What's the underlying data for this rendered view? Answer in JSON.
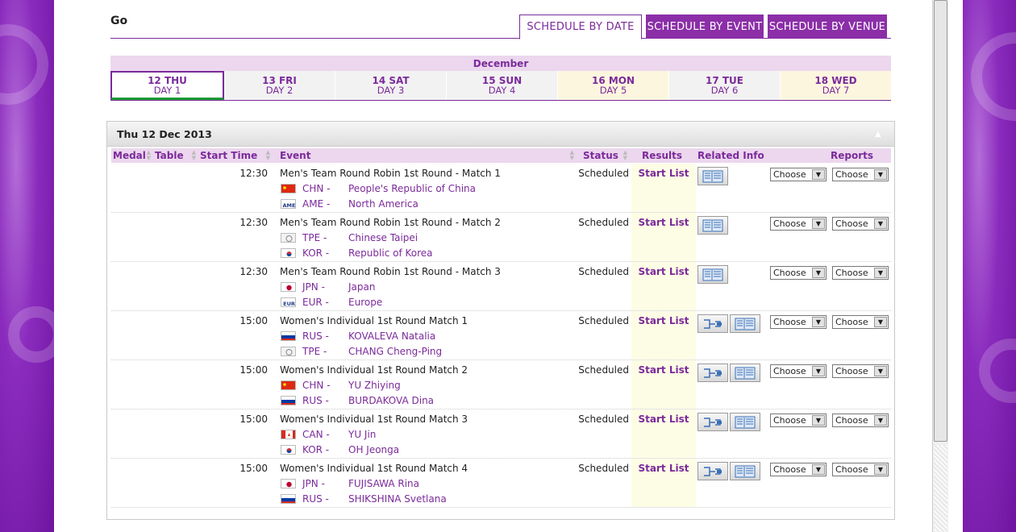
{
  "header": {
    "go_label": "Go",
    "tabs": [
      {
        "label": "SCHEDULE BY DATE",
        "active": true
      },
      {
        "label": "SCHEDULE BY EVENT",
        "active": false
      },
      {
        "label": "SCHEDULE BY VENUE",
        "active": false
      }
    ]
  },
  "calendar": {
    "month": "December",
    "days": [
      {
        "date": "12 THU",
        "day": "DAY 1"
      },
      {
        "date": "13 FRI",
        "day": "DAY 2"
      },
      {
        "date": "14 SAT",
        "day": "DAY 3"
      },
      {
        "date": "15 SUN",
        "day": "DAY 4"
      },
      {
        "date": "16 MON",
        "day": "DAY 5"
      },
      {
        "date": "17 TUE",
        "day": "DAY 6"
      },
      {
        "date": "18 WED",
        "day": "DAY 7"
      }
    ]
  },
  "panel": {
    "title": "Thu 12 Dec 2013",
    "columns": {
      "medal": "Medal",
      "table": "Table",
      "start_time": "Start Time",
      "event": "Event",
      "status": "Status",
      "results": "Results",
      "related_info": "Related Info",
      "reports": "Reports"
    },
    "choose_label": "Choose",
    "rows": [
      {
        "time": "12:30",
        "event": "Men's Team Round Robin 1st Round - Match 1",
        "status": "Scheduled",
        "result": "Start List",
        "c1": {
          "noc": "CHN -",
          "name": "People's Republic of China"
        },
        "c2": {
          "noc": "AME -",
          "name": "North America"
        }
      },
      {
        "time": "12:30",
        "event": "Men's Team Round Robin 1st Round - Match 2",
        "status": "Scheduled",
        "result": "Start List",
        "c1": {
          "noc": "TPE -",
          "name": "Chinese Taipei"
        },
        "c2": {
          "noc": "KOR -",
          "name": "Republic of Korea"
        }
      },
      {
        "time": "12:30",
        "event": "Men's Team Round Robin 1st Round - Match 3",
        "status": "Scheduled",
        "result": "Start List",
        "c1": {
          "noc": "JPN -",
          "name": "Japan"
        },
        "c2": {
          "noc": "EUR -",
          "name": "Europe"
        }
      },
      {
        "time": "15:00",
        "event": "Women's Individual 1st Round Match 1",
        "status": "Scheduled",
        "result": "Start List",
        "c1": {
          "noc": "RUS -",
          "name": "KOVALEVA Natalia"
        },
        "c2": {
          "noc": "TPE -",
          "name": "CHANG Cheng-Ping"
        }
      },
      {
        "time": "15:00",
        "event": "Women's Individual 1st Round Match 2",
        "status": "Scheduled",
        "result": "Start List",
        "c1": {
          "noc": "CHN -",
          "name": "YU Zhiying"
        },
        "c2": {
          "noc": "RUS -",
          "name": "BURDAKOVA Dina"
        }
      },
      {
        "time": "15:00",
        "event": "Women's Individual 1st Round Match 3",
        "status": "Scheduled",
        "result": "Start List",
        "c1": {
          "noc": "CAN -",
          "name": "YU Jin"
        },
        "c2": {
          "noc": "KOR -",
          "name": "OH Jeonga"
        }
      },
      {
        "time": "15:00",
        "event": "Women's Individual 1st Round Match 4",
        "status": "Scheduled",
        "result": "Start List",
        "c1": {
          "noc": "JPN -",
          "name": "FUJISAWA Rina"
        },
        "c2": {
          "noc": "RUS -",
          "name": "SHIKSHINA Svetlana"
        }
      }
    ]
  },
  "colors": {
    "accent": "#7b2a9a",
    "tab_bg": "#8b2ea8",
    "header_bg": "#ecd7ee",
    "active_day_underline": "#1a9a34"
  }
}
